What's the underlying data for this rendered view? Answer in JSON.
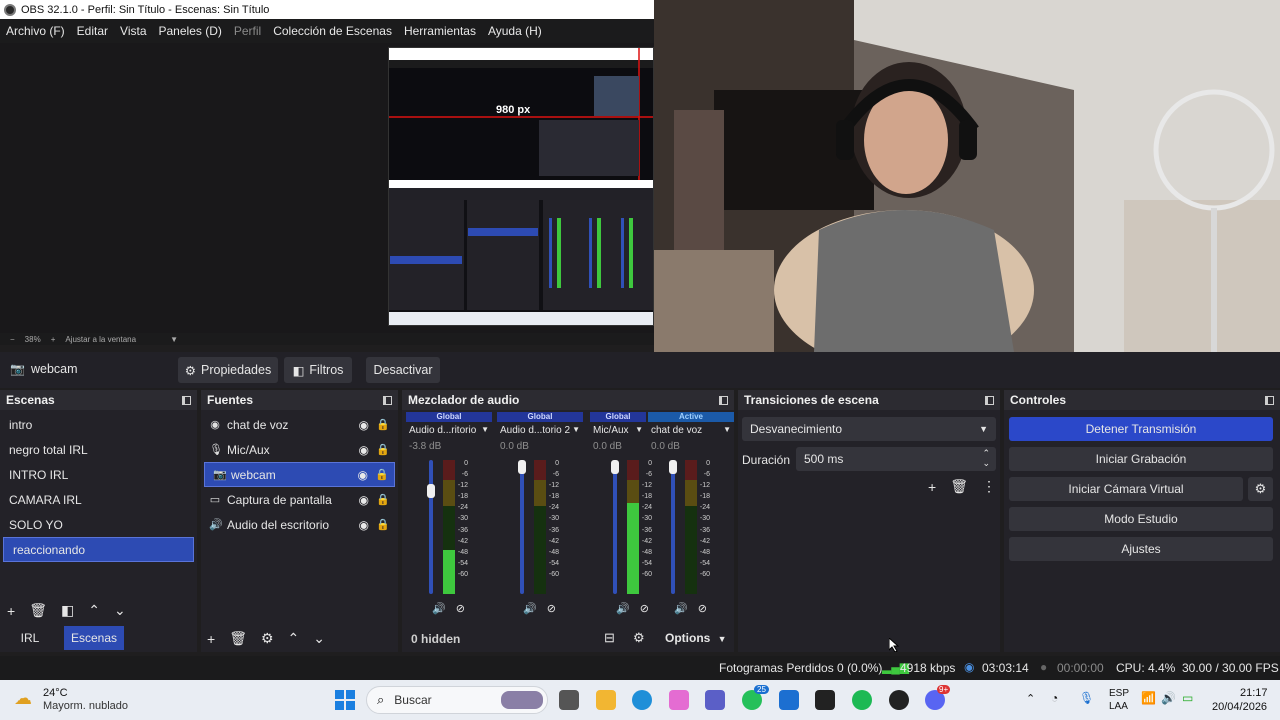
{
  "window": {
    "title": "OBS 32.1.0 - Perfil: Sin Título - Escenas: Sin Título"
  },
  "menu": [
    "Archivo (F)",
    "Editar",
    "Vista",
    "Paneles (D)",
    "Perfil",
    "Colección de Escenas",
    "Herramientas",
    "Ayuda (H)"
  ],
  "preview": {
    "measure_label": "980 px",
    "zoom_minus": "−",
    "zoom_value": "38%",
    "zoom_plus": "+",
    "zoom_fit": "Ajustar a la ventana"
  },
  "source_toolbar": {
    "source_name": "webcam",
    "properties": "Propiedades",
    "filters": "Filtros",
    "deactivate": "Desactivar"
  },
  "scenes": {
    "title": "Escenas",
    "items": [
      "intro",
      "negro total IRL",
      "INTRO IRL",
      "CAMARA IRL",
      "SOLO YO",
      "reaccionando"
    ],
    "selected_index": 5,
    "tabs": [
      "IRL",
      "Escenas"
    ]
  },
  "sources": {
    "title": "Fuentes",
    "items": [
      {
        "name": "chat de voz",
        "icon": "globe-icon"
      },
      {
        "name": "Mic/Aux",
        "icon": "microphone-icon"
      },
      {
        "name": "webcam",
        "icon": "camera-icon"
      },
      {
        "name": "Captura de pantalla",
        "icon": "monitor-icon"
      },
      {
        "name": "Audio del escritorio",
        "icon": "speaker-icon"
      }
    ],
    "selected_index": 2
  },
  "mixer": {
    "title": "Mezclador de audio",
    "channels": [
      {
        "badge": "Global",
        "name": "Audio d...ritorio",
        "db": "-3.8 dB",
        "level": 0.33,
        "fader": 0.8
      },
      {
        "badge": "Global",
        "name": "Audio d...torio 2",
        "db": "0.0 dB",
        "level": 0.0,
        "fader": 1.0
      },
      {
        "badge": "Global",
        "name": "Mic/Aux",
        "db": "0.0 dB",
        "level": 0.68,
        "fader": 1.0
      },
      {
        "badge": "Active",
        "name": "chat de voz",
        "db": "0.0 dB",
        "level": 0.0,
        "fader": 1.0
      }
    ],
    "ticks": [
      "0",
      "-6",
      "-12",
      "-18",
      "-24",
      "-30",
      "-36",
      "-42",
      "-48",
      "-54",
      "-60"
    ],
    "hidden": "0 hidden",
    "options": "Options"
  },
  "transitions": {
    "title": "Transiciones de escena",
    "selected": "Desvanecimiento",
    "duration_label": "Duración",
    "duration_value": "500 ms"
  },
  "controls": {
    "title": "Controles",
    "stop_stream": "Detener Transmisión",
    "start_recording": "Iniciar Grabación",
    "start_virtual_cam": "Iniciar Cámara Virtual",
    "studio_mode": "Modo Estudio",
    "settings": "Ajustes",
    "accent": "#2b48c9"
  },
  "status": {
    "dropped": "Fotogramas Perdidos 0 (0.0%)",
    "bitrate": "4918 kbps",
    "stream_time": "03:03:14",
    "rec_time": "00:00:00",
    "cpu": "CPU: 4.4%",
    "fps": "30.00 / 30.00 FPS"
  },
  "taskbar": {
    "weather_temp": "24°C",
    "weather_desc": "Mayorm. nublado",
    "search_placeholder": "Buscar",
    "whatsapp_badge": "25",
    "discord_badge": "9+",
    "lang": "ESP",
    "lang2": "LAA",
    "time": "21:17",
    "date": "20/04/2026"
  }
}
